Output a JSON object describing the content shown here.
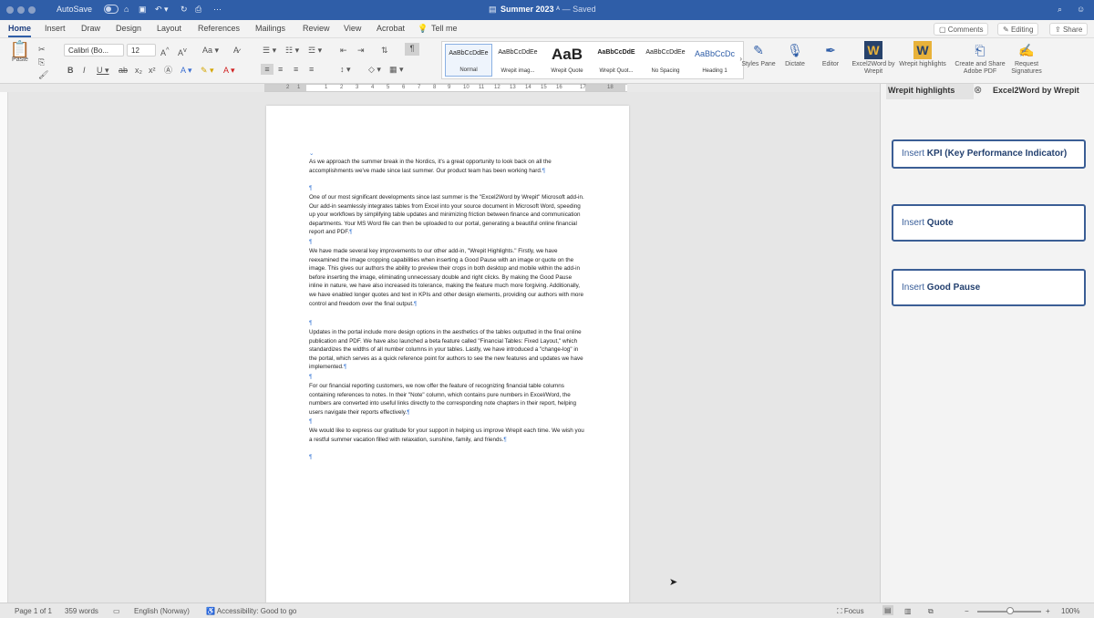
{
  "titlebar": {
    "autosave": "AutoSave",
    "doc_title": "Summer 2023",
    "status": "Saved",
    "toggle": "OFF"
  },
  "tabs": [
    "Home",
    "Insert",
    "Draw",
    "Design",
    "Layout",
    "References",
    "Mailings",
    "Review",
    "View",
    "Acrobat",
    "Tell me"
  ],
  "tab_buttons": {
    "comments": "Comments",
    "editing": "Editing",
    "share": "Share"
  },
  "ribbon": {
    "paste": "Paste",
    "font": "Calibri (Bo...",
    "font_size": "12",
    "styles": [
      {
        "preview": "AaBbCcDdEe",
        "name": "Normal"
      },
      {
        "preview": "AaBbCcDdEe",
        "name": "Wrepit imag..."
      },
      {
        "preview": "AaB",
        "name": "Wrepit Quote"
      },
      {
        "preview": "AaBbCcDdE",
        "name": "Wrepit Quot..."
      },
      {
        "preview": "AaBbCcDdEe",
        "name": "No Spacing"
      },
      {
        "preview": "AaBbCcDc",
        "name": "Heading 1"
      }
    ],
    "styles_pane": "Styles Pane",
    "dictate": "Dictate",
    "editor": "Editor",
    "excel2word": "Excel2Word by Wrepit",
    "wrepit_highlights": "Wrepit highlights",
    "create_pdf": "Create and Share Adobe PDF",
    "request_signatures": "Request Signatures"
  },
  "ruler_numbers": [
    "2",
    "1",
    "1",
    "2",
    "3",
    "4",
    "5",
    "6",
    "7",
    "8",
    "9",
    "10",
    "11",
    "12",
    "13",
    "14",
    "15",
    "16",
    "17",
    "18"
  ],
  "document": {
    "paragraphs": [
      "As we approach the summer break in the Nordics, it's a great opportunity to look back on all the accomplishments we've made since last summer. Our product team has been working hard.",
      "One of our most significant developments since last summer is the \"Excel2Word by Wrepit\" Microsoft add-in. Our add-in seamlessly integrates tables from Excel into your source document in Microsoft Word, speeding up your workflows by simplifying table updates and minimizing friction between finance and communication departments. Your MS Word file can then be uploaded to our portal, generating a beautiful online financial report and PDF.",
      "We have made several key improvements to our other add-in, \"Wrepit Highlights.\" Firstly, we have reexamined the image cropping capabilities when inserting a Good Pause with an image or quote on the image. This gives our authors the ability to preview their crops in both desktop and mobile within the add-in before inserting the image, eliminating unnecessary double and right clicks. By making the Good Pause inline in nature, we have also increased its tolerance, making the feature much more forgiving. Additionally, we have enabled longer quotes and text in KPIs and other design elements, providing our authors with more control and freedom over the final output.",
      "Updates in the portal include more design options in the aesthetics of the tables outputted in the final online publication and PDF. We have also launched a beta feature called \"Financial Tables: Fixed Layout,\" which standardizes the widths of all number columns in your tables. Lastly, we have introduced a \"change-log\" in the portal, which serves as a quick reference point for authors to see the new features and updates we have implemented.",
      "For our financial reporting customers, we now offer the feature of recognizing financial table columns containing references to notes. In their \"Note\" column, which contains pure numbers in Excel/Word, the numbers are converted into useful links directly to the corresponding note chapters in their report, helping users navigate their reports effectively.",
      "We would like to express our gratitude for your support in helping us improve Wrepit each time. We wish you a restful summer vacation filled with relaxation, sunshine, family, and friends."
    ],
    "pilcrow": "¶"
  },
  "pane": {
    "tab1": "Wrepit highlights",
    "tab2": "Excel2Word by Wrepit",
    "buttons": [
      {
        "prefix": "Insert",
        "bold": "KPI (Key Performance Indicator)"
      },
      {
        "prefix": "Insert",
        "bold": "Quote"
      },
      {
        "prefix": "Insert",
        "bold": "Good Pause"
      }
    ]
  },
  "status": {
    "page": "Page 1 of 1",
    "words": "359 words",
    "language": "English (Norway)",
    "accessibility": "Accessibility: Good to go",
    "focus": "Focus",
    "zoom": "100%"
  },
  "colors": {
    "accent": "#2f5ea8",
    "pane_border": "#3b5e95"
  }
}
